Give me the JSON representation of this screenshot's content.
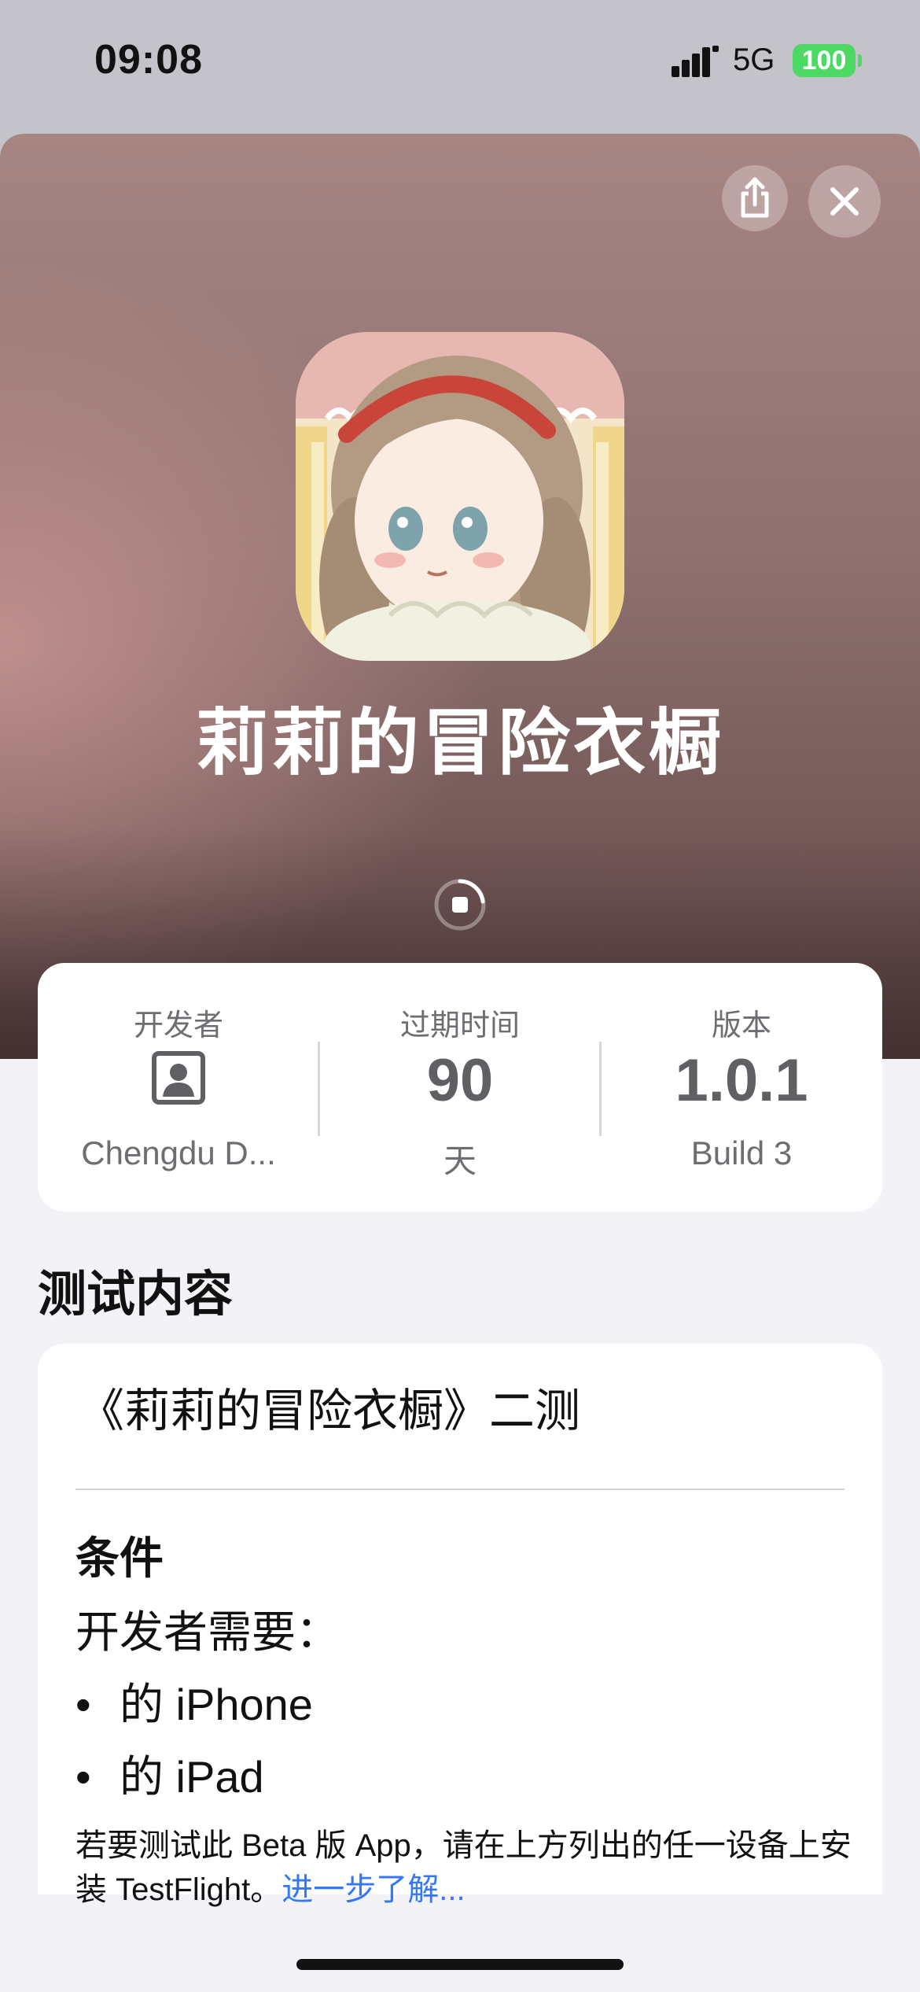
{
  "status_bar": {
    "time": "09:08",
    "network": "5G",
    "battery": "100",
    "battery_color": "#4cd964"
  },
  "header": {
    "share_icon": "share-icon",
    "close_icon": "close-icon",
    "app_title": "莉莉的冒险衣橱",
    "download_state": "progress-stop-icon"
  },
  "info": {
    "developer": {
      "label": "开发者",
      "icon": "developer-icon",
      "value": "Chengdu D..."
    },
    "expiry": {
      "label": "过期时间",
      "value": "90",
      "unit": "天"
    },
    "version": {
      "label": "版本",
      "value": "1.0.1",
      "build": "Build 3"
    }
  },
  "test_content": {
    "section_title": "测试内容",
    "whats_new": "《莉莉的冒险衣橱》二测",
    "requirements_title": "条件",
    "requirements_intro": "开发者需要：",
    "devices": [
      "的 iPhone",
      "的 iPad"
    ],
    "footnote_text": "若要测试此 Beta 版 App，请在上方列出的任一设备上安装 TestFlight。",
    "footnote_link": "进一步了解..."
  },
  "colors": {
    "accent": "#3478f6",
    "hero_top": "#a68583",
    "hero_bottom": "#4b3939",
    "background": "#f2f2f7"
  }
}
